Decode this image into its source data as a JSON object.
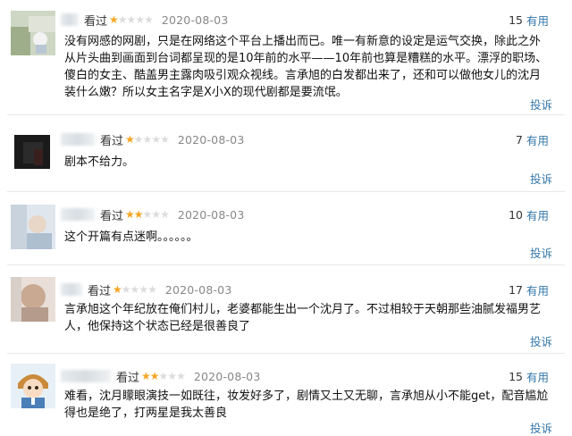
{
  "reviews": [
    {
      "status": "看过",
      "stars_filled": 1,
      "stars_total": 5,
      "date": "2020-08-03",
      "helpful_count": "15",
      "helpful_label": "有用",
      "content": "没有网感的网剧，只是在网络这个平台上播出而已。唯一有新意的设定是运气交换，除此之外从片头曲到画面到台词都呈现的是10年前的水平——10年前也算是糟糕的水平。漂浮的职场、傻白的女主、酷盖男主露肉吸引观众视线。言承旭的白发都出来了，还和可以做他女儿的沈月装什么嫩？所以女主名字是X小X的现代剧都是要流氓。",
      "report_label": "投诉"
    },
    {
      "status": "看过",
      "stars_filled": 1,
      "stars_total": 5,
      "date": "2020-08-03",
      "helpful_count": "7",
      "helpful_label": "有用",
      "content": "剧本不给力。",
      "report_label": "投诉"
    },
    {
      "status": "看过",
      "stars_filled": 2,
      "stars_total": 5,
      "date": "2020-08-03",
      "helpful_count": "10",
      "helpful_label": "有用",
      "content": "这个开篇有点迷啊。。。。。。",
      "report_label": "投诉"
    },
    {
      "status": "看过",
      "stars_filled": 1,
      "stars_total": 5,
      "date": "2020-08-03",
      "helpful_count": "17",
      "helpful_label": "有用",
      "content": "言承旭这个年纪放在俺们村儿，老婆都能生出一个沈月了。不过相较于天朝那些油腻发福男艺人，他保持这个状态已经是很善良了",
      "report_label": "投诉"
    },
    {
      "status": "看过",
      "stars_filled": 2,
      "stars_total": 5,
      "date": "2020-08-03",
      "helpful_count": "15",
      "helpful_label": "有用",
      "content": "难看，沈月矇眼演技一如既往，妆发好多了，剧情又土又无聊，言承旭从小不能get，配音尴尬得也是绝了，打两星是我太善良",
      "report_label": "投诉"
    }
  ],
  "colors": {
    "link": "#3377aa",
    "star_on": "#f5a623",
    "star_off": "#dcdcdc",
    "date": "#888888"
  }
}
